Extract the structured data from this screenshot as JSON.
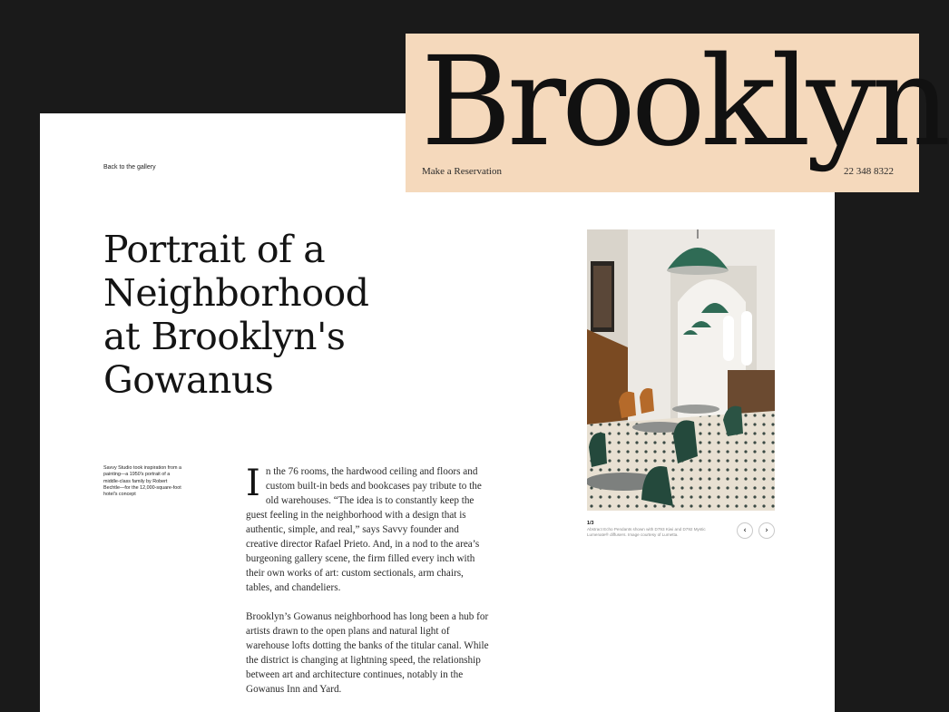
{
  "nav": {
    "back_label": "Back to the gallery"
  },
  "brand": {
    "title": "Brooklyn",
    "reserve_label": "Make a Reservation",
    "phone": "22 348 8322",
    "background_color": "#f5d9bc"
  },
  "article": {
    "headline": "Portrait of a Neighborhood at Brooklyn's Gowanus",
    "side_note": "Savvy Studio took inspiration from a painting—a 1950's portrait of a middle-class family by Robert Bechtle—for the 12,000-square-foot hotel's concept",
    "drop_cap": "I",
    "paragraph_1": "n the 76 rooms, the hardwood ceiling and floors and custom built-in beds and bookcases pay tribute to the old warehouses. “The idea is to constantly keep the guest feeling in the neighborhood with a design that is authentic, simple, and real,” says Savvy founder and creative director Rafael Prieto. And, in a nod to the area’s burgeoning gallery scene, the firm filled every inch with their own works of art: custom sectionals, arm chairs, tables, and chandeliers.",
    "paragraph_2": "Brooklyn’s Gowanus neighborhood has long been a hub for artists drawn to the open plans and natural light of warehouse lofts dotting the banks of the titular canal. While the district is changing at lightning speed, the relationship between art and architecture continues, notably in the Gowanus Inn and Yard."
  },
  "gallery": {
    "counter": "1/3",
    "caption": "Abstract Echo Pendants shown with D793 Kiwi and D792 Mystic Lumenate® diffusers. Image courtesy of Lumetta.",
    "prev_icon": "chevron-left-icon",
    "next_icon": "chevron-right-icon"
  }
}
